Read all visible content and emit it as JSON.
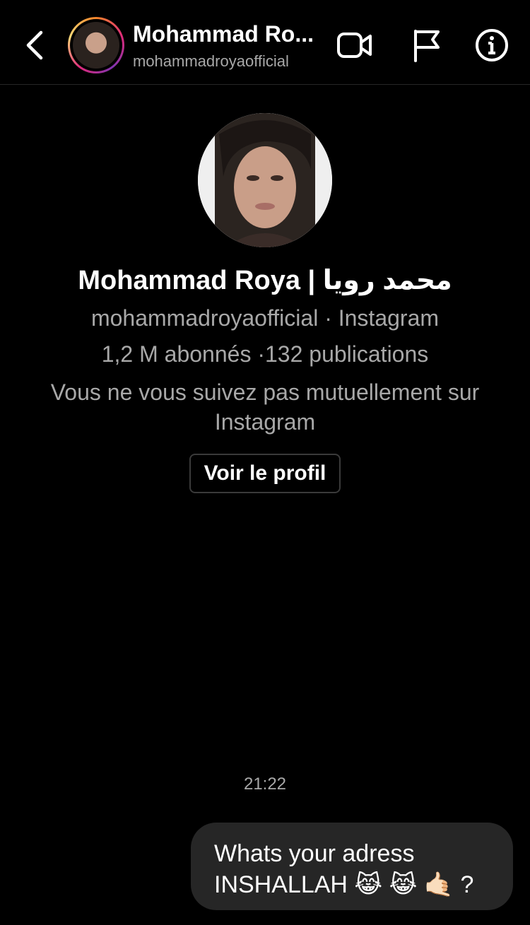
{
  "header": {
    "name": "Mohammad Ro...",
    "username": "mohammadroyaofficial",
    "icons": {
      "back": "chevron-left-icon",
      "video": "video-camera-icon",
      "flag": "flag-icon",
      "info": "info-icon"
    }
  },
  "profile": {
    "name": "Mohammad Roya | محمد رویا",
    "username_line": "mohammadroyaofficial · Instagram",
    "stats_line": "1,2 M abonnés ·132 publications",
    "mutual_line": "Vous ne vous suivez pas mutuellement sur Instagram",
    "view_profile_label": "Voir le profil"
  },
  "conversation": {
    "timestamp": "21:22",
    "messages": [
      {
        "line1": "Whats your adress",
        "line2": "INSHALLAH 😹 😹 🤙🏻 ?"
      }
    ]
  },
  "colors": {
    "background": "#000000",
    "bubble": "#262626",
    "secondary_text": "#a8a8a8",
    "divider": "#262626"
  }
}
